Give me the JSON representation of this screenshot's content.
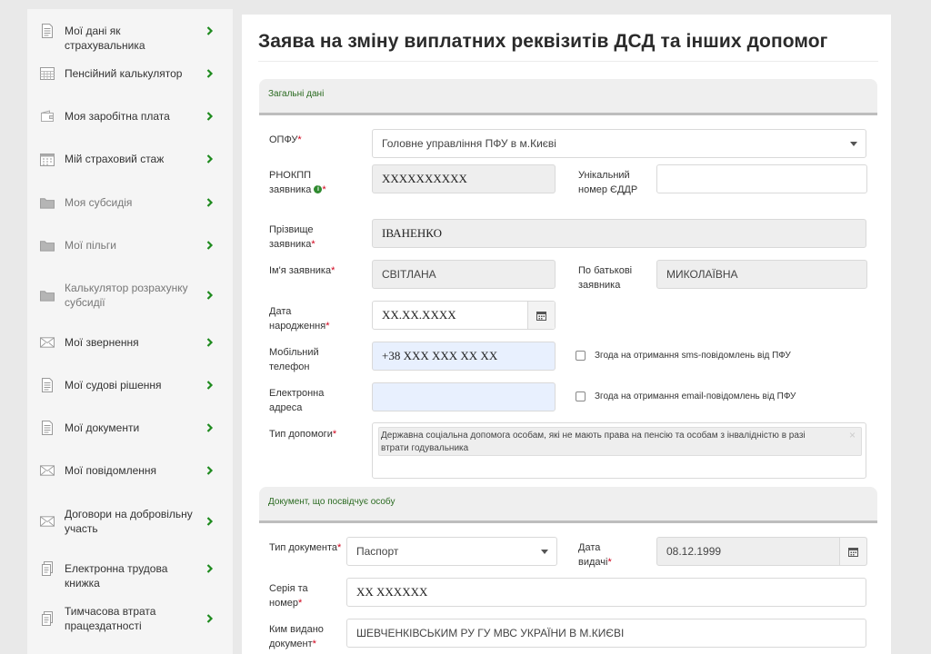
{
  "sidebar": {
    "items": [
      {
        "label": "Мої дані як страхувальника",
        "icon": "document-icon"
      },
      {
        "label": "Пенсійний калькулятор",
        "icon": "calculator-icon"
      },
      {
        "label": "Моя заробітна плата",
        "icon": "wallet-icon"
      },
      {
        "label": "Мій страховий стаж",
        "icon": "calendar-icon"
      },
      {
        "label": "Моя субсидія",
        "icon": "folder-icon"
      },
      {
        "label": "Мої пільги",
        "icon": "folder-icon"
      },
      {
        "label": "Калькулятор розрахунку субсидії",
        "icon": "folder-icon"
      },
      {
        "label": "Мої звернення",
        "icon": "envelope-icon"
      },
      {
        "label": "Мої судові рішення",
        "icon": "document-icon"
      },
      {
        "label": "Мої документи",
        "icon": "document-icon"
      },
      {
        "label": "Мої повідомлення",
        "icon": "envelope-icon"
      },
      {
        "label": "Договори на добровільну участь",
        "icon": "envelope-icon"
      },
      {
        "label": "Електронна трудова книжка",
        "icon": "workbook-icon"
      },
      {
        "label": "Тимчасова втрата працездатності",
        "icon": "workbook-icon"
      }
    ]
  },
  "page": {
    "title": "Заява на зміну виплатних реквізитів ДСД та інших допомог"
  },
  "general": {
    "section_title": "Загальні дані",
    "opfu": {
      "label": "ОПФУ",
      "value": "Головне управління ПФУ в м.Києві"
    },
    "rnokpp": {
      "label": "РНОКПП заявника",
      "value": "XXXXXXXXXX"
    },
    "edrr": {
      "label": "Унікальний номер ЄДДР",
      "value": ""
    },
    "surname": {
      "label": "Прізвище заявника",
      "value": "ІВАНЕНКО"
    },
    "firstname": {
      "label": "Ім'я заявника",
      "value": "СВІТЛАНА"
    },
    "patronymic": {
      "label": "По батькові заявника",
      "value": "МИКОЛАЇВНА"
    },
    "birth": {
      "label": "Дата народження",
      "value": "XX.XX.XXXX"
    },
    "phone": {
      "label": "Мобільний телефон",
      "value": "+38 XXX XXX XX XX"
    },
    "sms_consent": "Згода на отримання sms-повідомлень від ПФУ",
    "email": {
      "label": "Електронна адреса",
      "value": ""
    },
    "email_consent": "Згода на отримання email-повідомлень від ПФУ",
    "aid_type": {
      "label": "Тип допомоги",
      "value": "Державна соціальна допомога особам, які не мають права на пенсію та особам з інвалідністю в разі втрати годувальника",
      "remove": "×"
    }
  },
  "identity": {
    "section_title": "Документ, що посвідчує особу",
    "doc_type": {
      "label": "Тип документа",
      "value": "Паспорт"
    },
    "issue_date": {
      "label": "Дата видачі",
      "value": "08.12.1999"
    },
    "series": {
      "label": "Серія та номер",
      "value": "XX XXXXXX"
    },
    "issued_by": {
      "label": "Ким видано документ",
      "value": "ШЕВЧЕНКІВСЬКИМ РУ ГУ МВС УКРАЇНИ В М.КИЄВІ"
    }
  },
  "required_mark": "*",
  "info_mark": "i",
  "colors": {
    "accent": "#2a6a20",
    "required": "#d0021b",
    "autofill": "#e8f0fe"
  }
}
